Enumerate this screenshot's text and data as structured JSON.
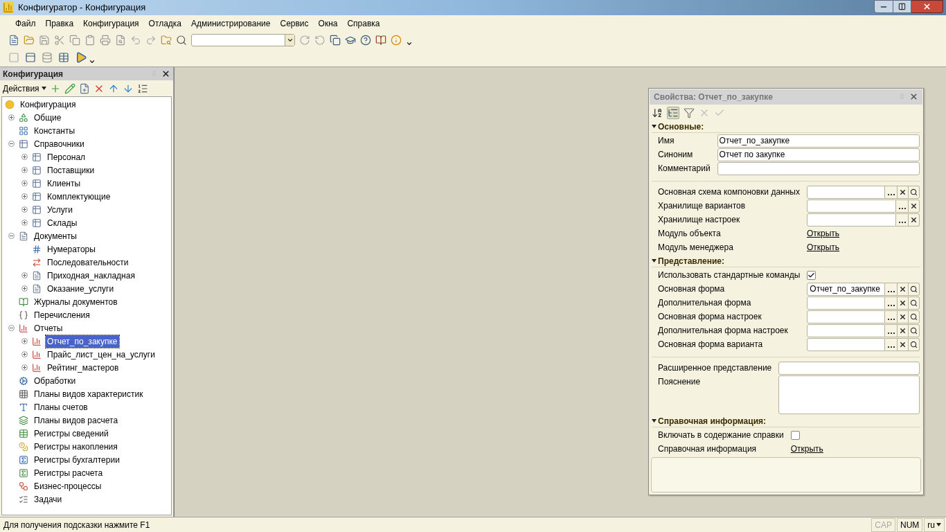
{
  "window": {
    "title": "Конфигуратор - Конфигурация"
  },
  "menu": [
    {
      "label": "Файл"
    },
    {
      "label": "Правка"
    },
    {
      "label": "Конфигурация"
    },
    {
      "label": "Отладка"
    },
    {
      "label": "Администрирование"
    },
    {
      "label": "Сервис"
    },
    {
      "label": "Окна"
    },
    {
      "label": "Справка"
    }
  ],
  "config_panel": {
    "title": "Конфигурация",
    "actions_label": "Действия",
    "tree": [
      {
        "label": "Конфигурация",
        "kind": "root",
        "selected": false,
        "children": [
          {
            "label": "Общие",
            "kind": "common",
            "expanded": false,
            "selected": false
          },
          {
            "label": "Константы",
            "kind": "constants",
            "selected": false
          },
          {
            "label": "Справочники",
            "kind": "catalog",
            "expanded": true,
            "selected": false,
            "children": [
              {
                "label": "Персонал",
                "kind": "catalog",
                "expanded": false,
                "selected": false
              },
              {
                "label": "Поставщики",
                "kind": "catalog",
                "expanded": false,
                "selected": false
              },
              {
                "label": "Клиенты",
                "kind": "catalog",
                "expanded": false,
                "selected": false
              },
              {
                "label": "Комплектующие",
                "kind": "catalog",
                "expanded": false,
                "selected": false
              },
              {
                "label": "Услуги",
                "kind": "catalog",
                "expanded": false,
                "selected": false
              },
              {
                "label": "Склады",
                "kind": "catalog",
                "expanded": false,
                "selected": false
              }
            ]
          },
          {
            "label": "Документы",
            "kind": "document",
            "expanded": true,
            "selected": false,
            "children": [
              {
                "label": "Нумераторы",
                "kind": "numerator",
                "selected": false
              },
              {
                "label": "Последовательности",
                "kind": "sequence",
                "selected": false
              },
              {
                "label": "Приходная_накладная",
                "kind": "document",
                "expanded": false,
                "selected": false
              },
              {
                "label": "Оказание_услуги",
                "kind": "document",
                "expanded": false,
                "selected": false
              }
            ]
          },
          {
            "label": "Журналы документов",
            "kind": "journal",
            "selected": false
          },
          {
            "label": "Перечисления",
            "kind": "enum",
            "selected": false
          },
          {
            "label": "Отчеты",
            "kind": "report",
            "expanded": true,
            "selected": false,
            "children": [
              {
                "label": "Отчет_по_закупке",
                "kind": "report",
                "expanded": false,
                "selected": true
              },
              {
                "label": "Прайс_лист_цен_на_услуги",
                "kind": "report",
                "expanded": false,
                "selected": false
              },
              {
                "label": "Рейтинг_мастеров",
                "kind": "report",
                "expanded": false,
                "selected": false
              }
            ]
          },
          {
            "label": "Обработки",
            "kind": "processing",
            "selected": false
          },
          {
            "label": "Планы видов характеристик",
            "kind": "char-types",
            "selected": false
          },
          {
            "label": "Планы счетов",
            "kind": "accounts",
            "selected": false
          },
          {
            "label": "Планы видов расчета",
            "kind": "calc-types",
            "selected": false
          },
          {
            "label": "Регистры сведений",
            "kind": "info-reg",
            "selected": false
          },
          {
            "label": "Регистры накопления",
            "kind": "accum-reg",
            "selected": false
          },
          {
            "label": "Регистры бухгалтерии",
            "kind": "account-reg",
            "selected": false
          },
          {
            "label": "Регистры расчета",
            "kind": "calc-reg",
            "selected": false
          },
          {
            "label": "Бизнес-процессы",
            "kind": "business",
            "selected": false
          },
          {
            "label": "Задачи",
            "kind": "tasks",
            "selected": false
          }
        ]
      }
    ]
  },
  "properties": {
    "title": "Свойства: Отчет_по_закупке",
    "sections": [
      {
        "title": "Основные:",
        "expanded": true,
        "groups": [
          [
            {
              "kind": "text",
              "label": "Имя",
              "value": "Отчет_по_закупке"
            },
            {
              "kind": "text",
              "label": "Синоним",
              "value": "Отчет по закупке"
            },
            {
              "kind": "text",
              "label": "Комментарий"
            }
          ],
          [
            {
              "kind": "choice",
              "label": "Основная схема компоновки данных",
              "search": true
            },
            {
              "kind": "choice",
              "label": "Хранилище вариантов",
              "search": false
            },
            {
              "kind": "choice",
              "label": "Хранилище настроек",
              "search": false
            },
            {
              "kind": "link",
              "label": "Модуль объекта",
              "value": "Открыть"
            },
            {
              "kind": "link",
              "label": "Модуль менеджера",
              "value": "Открыть"
            }
          ]
        ]
      },
      {
        "title": "Представление:",
        "expanded": true,
        "groups": [
          [
            {
              "kind": "checkbox",
              "label": "Использовать стандартные команды",
              "checked": true
            },
            {
              "kind": "choice",
              "label": "Основная форма",
              "value": "Отчет_по_закупке",
              "search": true
            },
            {
              "kind": "choice",
              "label": "Дополнительная форма",
              "search": true
            },
            {
              "kind": "choice",
              "label": "Основная форма настроек",
              "search": true
            },
            {
              "kind": "choice",
              "label": "Дополнительная форма настроек",
              "search": true
            },
            {
              "kind": "choice",
              "label": "Основная форма варианта",
              "search": true
            }
          ],
          [
            {
              "kind": "text",
              "label": "Расширенное представление"
            },
            {
              "kind": "textarea",
              "label": "Пояснение"
            }
          ]
        ]
      },
      {
        "title": "Справочная информация:",
        "expanded": true,
        "groups": [
          [
            {
              "kind": "checkbox",
              "label": "Включать в содержание справки",
              "checked": false
            },
            {
              "kind": "link",
              "label": "Справочная информация",
              "value": "Открыть"
            }
          ]
        ]
      }
    ]
  },
  "status_bar": {
    "hint": "Для получения подсказки нажмите F1",
    "indicators": [
      {
        "label": "CAP",
        "on": false
      },
      {
        "label": "NUM",
        "on": true
      }
    ],
    "language": "ru"
  }
}
